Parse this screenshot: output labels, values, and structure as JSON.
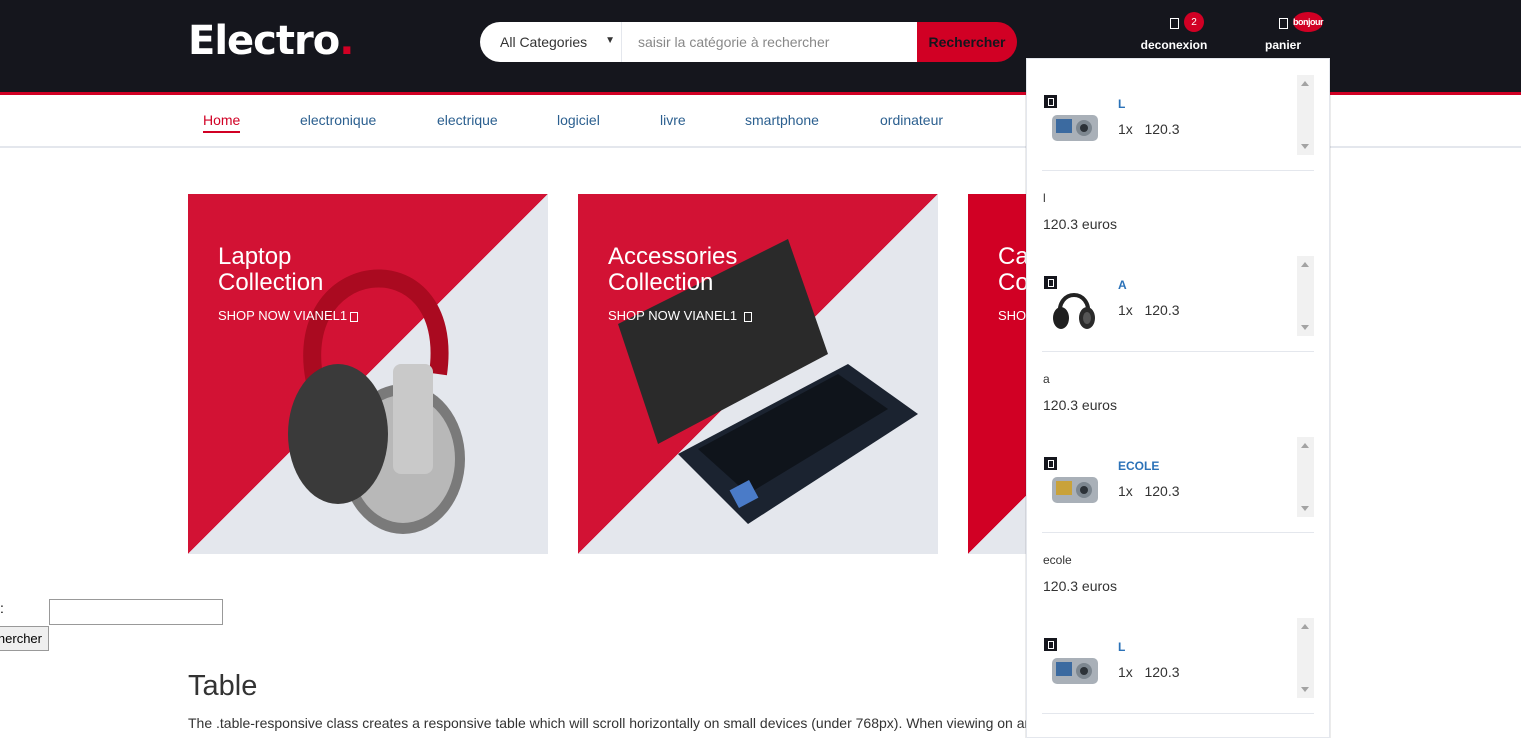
{
  "header": {
    "logo_text": "Electro",
    "logo_dot": ".",
    "search": {
      "category": "All Categories",
      "placeholder": "saisir la catégorie à rechercher",
      "button": "Rechercher"
    },
    "account": {
      "label": "deconexion",
      "badge": "2"
    },
    "cart": {
      "label": "panier",
      "badge": "bonjour"
    }
  },
  "nav": {
    "items": [
      "Home",
      "electronique",
      "electrique",
      "logiciel",
      "livre",
      "smartphone",
      "ordinateur"
    ],
    "active": "Home"
  },
  "collections": [
    {
      "title_line1": "Laptop",
      "title_line2": "Collection",
      "cta": "SHOP NOW VIANEL1"
    },
    {
      "title_line1": "Accessories",
      "title_line2": "Collection",
      "cta": "SHOP NOW VIANEL1"
    },
    {
      "title_line1": "Ca",
      "title_line2": "Co",
      "cta": "SHO"
    }
  ],
  "form": {
    "label": ":",
    "button": "echercher"
  },
  "table_section": {
    "title": "Table",
    "description": "The .table-responsive class creates a responsive table which will scroll horizontally on small devices (under 768px). When viewing on an"
  },
  "cart_dropdown": {
    "items": [
      {
        "name": "L",
        "qty": "1x",
        "price": "120.3",
        "note": "l",
        "total": "120.3 euros",
        "thumb": "camera"
      },
      {
        "name": "A",
        "qty": "1x",
        "price": "120.3",
        "note": "a",
        "total": "120.3 euros",
        "thumb": "headphones"
      },
      {
        "name": "ECOLE",
        "qty": "1x",
        "price": "120.3",
        "note": "ecole",
        "total": "120.3 euros",
        "thumb": "camera"
      },
      {
        "name": "L",
        "qty": "1x",
        "price": "120.3",
        "thumb": "camera"
      }
    ]
  },
  "colors": {
    "primary": "#d10024",
    "header_bg": "#15161d",
    "link": "#2b5f8f",
    "card_bg": "#e4e7ed"
  }
}
